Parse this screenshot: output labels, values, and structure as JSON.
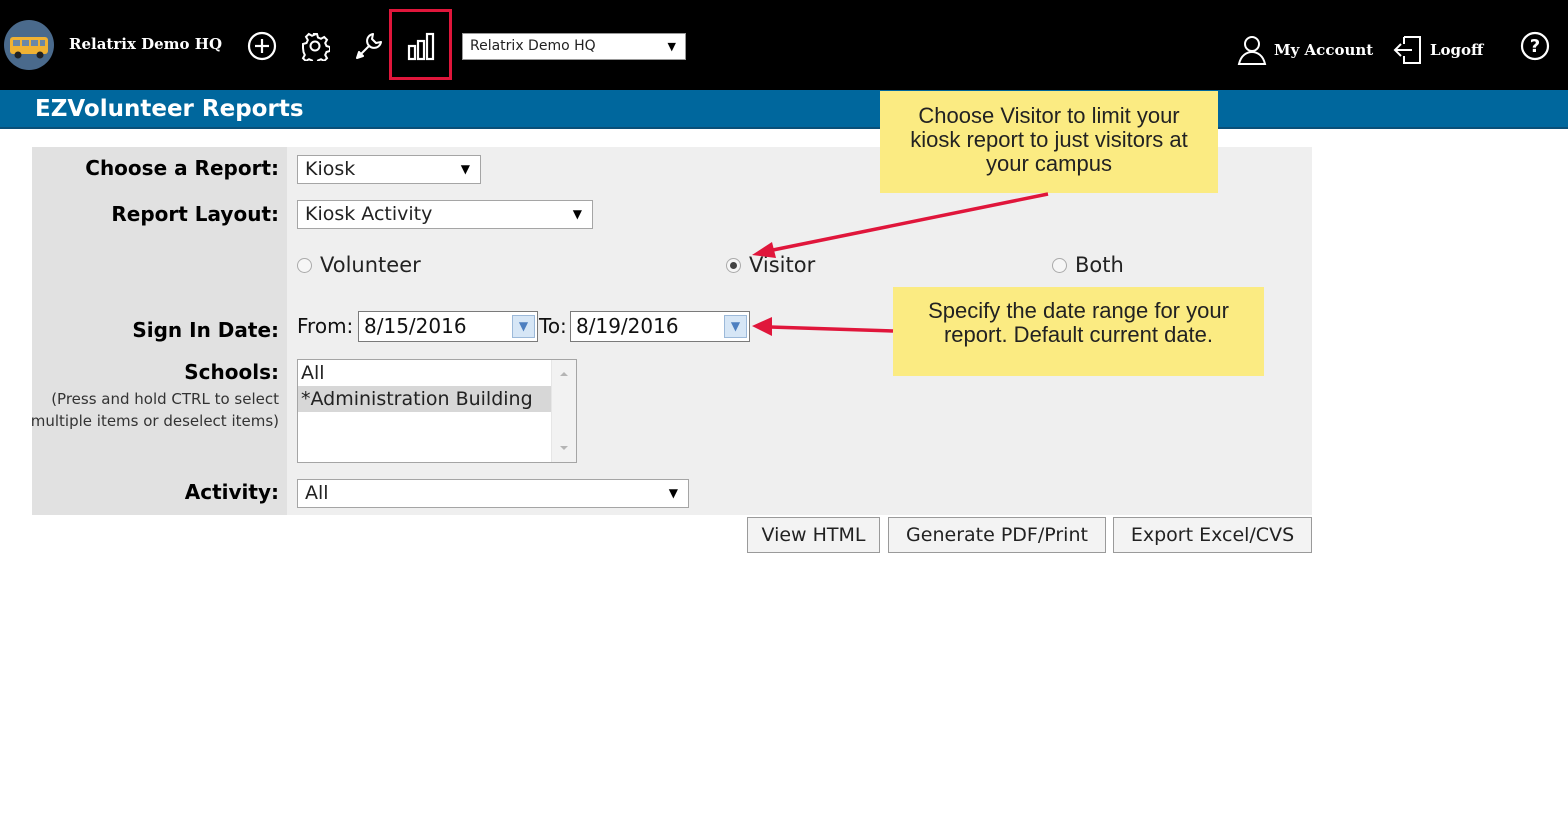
{
  "topbar": {
    "brand": "Relatrix Demo HQ",
    "icons": [
      "bus-logo-icon",
      "add-circle-icon",
      "gear-icon",
      "wrench-icon",
      "bar-chart-icon"
    ],
    "site_select": {
      "value": "Relatrix Demo HQ"
    },
    "my_account": "My Account",
    "logoff": "Logoff",
    "help_icon": "help-circle-icon"
  },
  "page": {
    "title": "EZVolunteer Reports"
  },
  "form": {
    "report_label": "Choose a Report:",
    "report_value": "Kiosk",
    "layout_label": "Report Layout:",
    "layout_value": "Kiosk Activity",
    "radio_options": [
      {
        "label": "Volunteer",
        "checked": false
      },
      {
        "label": "Visitor",
        "checked": true
      },
      {
        "label": "Both",
        "checked": false
      }
    ],
    "sign_in_label": "Sign In Date:",
    "from_label": "From:",
    "from_value": "8/15/2016",
    "to_label": "To:",
    "to_value": "8/19/2016",
    "schools_label": "Schools:",
    "schools_hint": "(Press and hold CTRL to select multiple items or deselect items)",
    "schools_options": [
      {
        "label": "All",
        "selected": false
      },
      {
        "label": "*Administration Building",
        "selected": true
      }
    ],
    "activity_label": "Activity:",
    "activity_value": "All"
  },
  "buttons": {
    "view_html": "View HTML",
    "generate_pdf": "Generate PDF/Print",
    "export_excel": "Export Excel/CVS"
  },
  "callouts": {
    "visitor": "Choose Visitor to limit your kiosk report to just visitors at your campus",
    "date_range": "Specify the date range for your report. Default current date."
  },
  "colors": {
    "topbar": "#000000",
    "titlebar": "#00679d",
    "callout": "#fbeb82",
    "arrow": "#e0163b",
    "highlight": "#e0163b"
  }
}
